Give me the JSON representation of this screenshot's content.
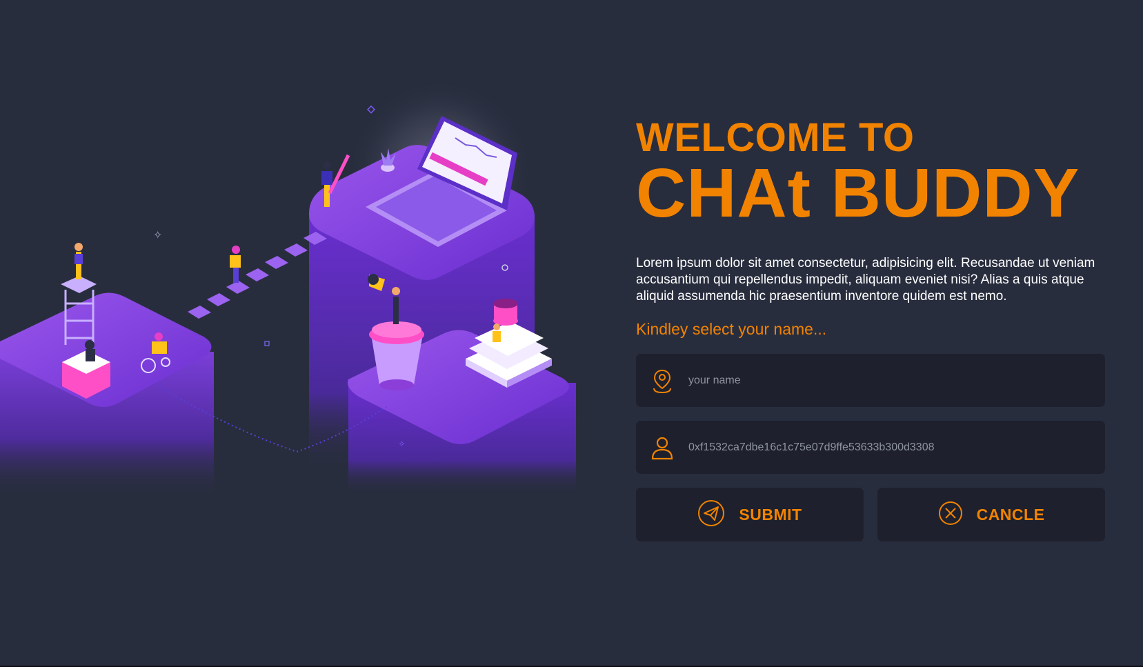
{
  "hero": {
    "welcome": "WELCOME TO",
    "app_name": "CHAt BUDDY",
    "description": "Lorem ipsum dolor sit amet consectetur, adipisicing elit. Recusandae ut veniam accusantium qui repellendus impedit, aliquam eveniet nisi? Alias a quis atque aliquid assumenda hic praesentium inventore quidem est nemo.",
    "prompt": "Kindley select your name..."
  },
  "form": {
    "name_field": {
      "placeholder": "your name",
      "value": "",
      "icon": "location-pin-icon"
    },
    "address_field": {
      "placeholder": "0xf1532ca7dbe16c1c75e07d9ffe53633b300d3308",
      "value": "",
      "icon": "user-icon"
    }
  },
  "buttons": {
    "submit": {
      "label": "SUBMIT",
      "icon": "send-icon"
    },
    "cancel": {
      "label": "CANCLE",
      "icon": "close-circle-icon"
    }
  },
  "colors": {
    "background": "#282d3e",
    "panel": "#1e212d",
    "accent": "#f28300",
    "text": "#ffffff",
    "placeholder": "#8f93a0",
    "illustration_primary": "#7b3fd6"
  }
}
